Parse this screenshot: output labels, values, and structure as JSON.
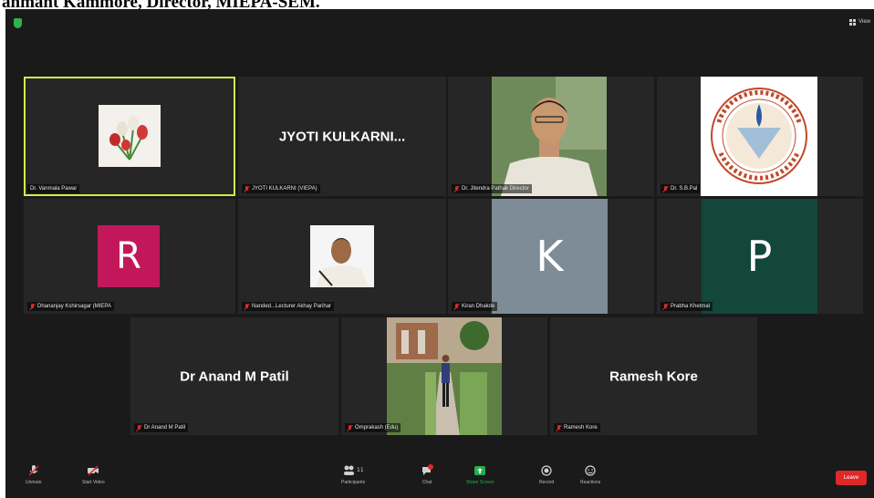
{
  "document": {
    "caption": "anmant Kammore, Director, MIEPA-SEM."
  },
  "header": {
    "view_label": "View"
  },
  "tiles": [
    {
      "name": "Dr. Vanmala Pawar",
      "display": "",
      "active": true
    },
    {
      "name": "JYOTI KULKARNI (VIEPA)",
      "display": "JYOTI  KULKARNI..."
    },
    {
      "name": "Dr. Jitendra Pathak Director",
      "display": ""
    },
    {
      "name": "Dr. S.B.Pal",
      "display": ""
    },
    {
      "name": "Dhananjay Kshirsagar (MIEPA",
      "display": "",
      "avatar_letter": "R",
      "avatar_color": "#c2185b"
    },
    {
      "name": "Nanded...Lecturer Akhay Parihar",
      "display": ""
    },
    {
      "name": "Kiran Dhakde",
      "display": "",
      "avatar_letter": "K",
      "avatar_color": "#7d8c96"
    },
    {
      "name": "Prabha Khetmal",
      "display": "",
      "avatar_letter": "P",
      "avatar_color": "#12473a"
    },
    {
      "name": "Dr Anand M Patil",
      "display": "Dr Anand M Patil"
    },
    {
      "name": "Omprakash (Edu)",
      "display": ""
    },
    {
      "name": "Ramesh Kore",
      "display": "Ramesh Kore"
    }
  ],
  "toolbar": {
    "unmute": "Unmute",
    "start_video": "Start Video",
    "participants": "Participants",
    "participants_count": "11",
    "chat": "Chat",
    "share_screen": "Share Screen",
    "record": "Record",
    "reactions": "Reactions",
    "leave": "Leave"
  },
  "colors": {
    "window_bg": "#1a1a1a",
    "tile_bg": "#262626",
    "active_outline": "#d7e84c",
    "leave": "#e02828",
    "share_screen": "#21b04b"
  }
}
